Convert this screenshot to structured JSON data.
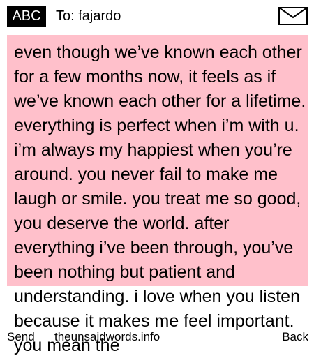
{
  "header": {
    "input_mode": "ABC",
    "to_text": "To: fajardo",
    "icon": "envelope-icon"
  },
  "message": {
    "text": "even though we’ve known each other for a few months now, it feels as if we’ve known each other for a lifetime. everything is perfect when i’m with u. i’m always my happiest when you’re around. you never fail to make me laugh or smile. you treat me so good, you deserve the world. after everything i’ve been through, you’ve been nothing but patient and understanding. i love when you listen because it makes me feel important. you mean the",
    "background_color": "#ffc0cb"
  },
  "softkeys": {
    "left": "Send",
    "center": "theunsaidwords.info",
    "right": "Back"
  }
}
